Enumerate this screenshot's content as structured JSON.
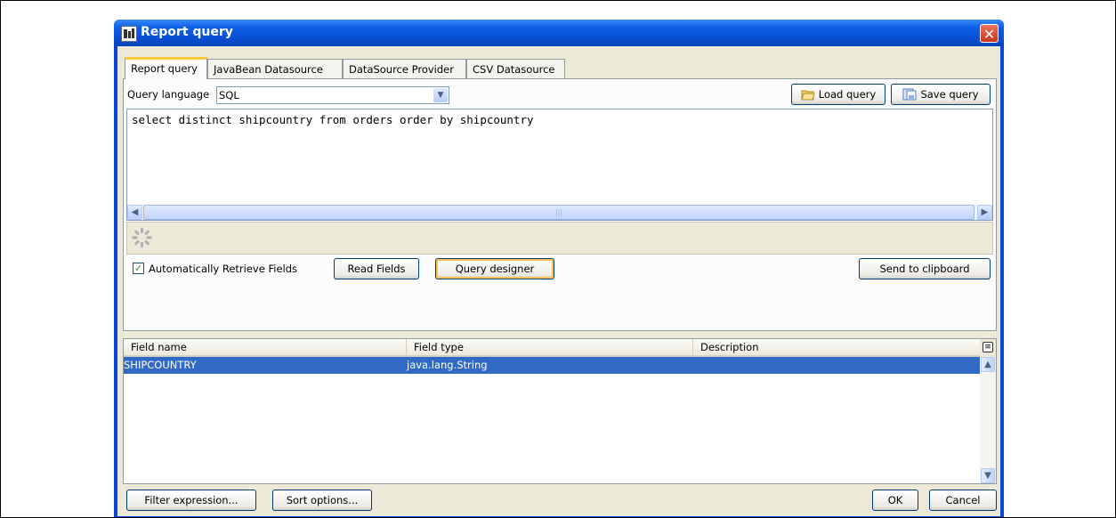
{
  "window": {
    "title": "Report query",
    "close_glyph": "✕"
  },
  "tabs": [
    "Report query",
    "JavaBean Datasource",
    "DataSource Provider",
    "CSV Datasource"
  ],
  "query": {
    "language_label": "Query language",
    "language_value": "SQL",
    "load_label": "Load query",
    "save_label": "Save query",
    "text": "select distinct shipcountry from orders order by shipcountry",
    "scroll_thumb_grip": "|||"
  },
  "options": {
    "auto_retrieve_label": "Automatically Retrieve Fields",
    "auto_retrieve_checked": true,
    "read_fields_label": "Read Fields",
    "query_designer_label": "Query designer",
    "send_clipboard_label": "Send to clipboard"
  },
  "fields_table": {
    "columns": [
      "Field name",
      "Field type",
      "Description"
    ],
    "rows": [
      {
        "name": "SHIPCOUNTRY",
        "type": "java.lang.String",
        "description": ""
      }
    ]
  },
  "footer": {
    "filter_label": "Filter expression...",
    "sort_label": "Sort options...",
    "ok_label": "OK",
    "cancel_label": "Cancel"
  },
  "colors": {
    "titlebar": "#0a4fd2",
    "selection": "#316ac5",
    "dialog_bg": "#ece9d8",
    "focus_accent": "#f7c24f"
  }
}
